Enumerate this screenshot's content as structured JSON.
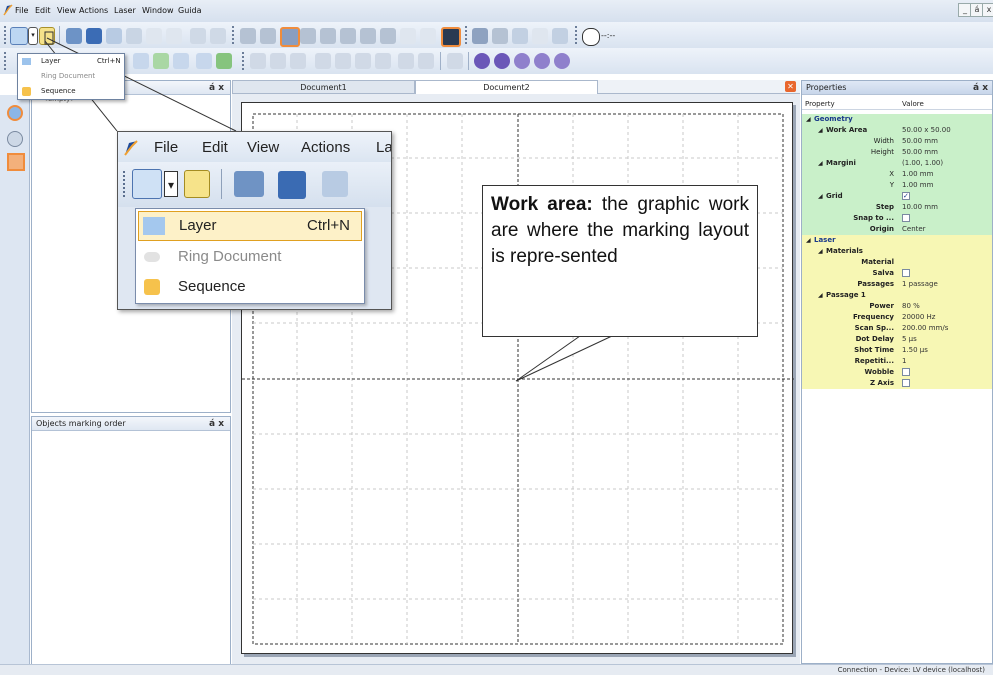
{
  "menubar": {
    "items": [
      "File",
      "Edit",
      "View",
      "Actions",
      "Laser",
      "Window",
      "Guida"
    ],
    "window_buttons": [
      "_",
      "á",
      "x"
    ]
  },
  "toolbar": {
    "time_readout": "--:--"
  },
  "dropdown": {
    "items": [
      {
        "label": "Layer",
        "shortcut": "Ctrl+N",
        "enabled": true
      },
      {
        "label": "Ring Document",
        "shortcut": "",
        "enabled": false
      },
      {
        "label": "Sequence",
        "shortcut": "",
        "enabled": true
      }
    ]
  },
  "zoom_inset": {
    "menu": [
      "File",
      "Edit",
      "View",
      "Actions",
      "La"
    ],
    "items": [
      {
        "label": "Layer",
        "shortcut": "Ctrl+N"
      },
      {
        "label": "Ring Document",
        "shortcut": ""
      },
      {
        "label": "Sequence",
        "shortcut": ""
      }
    ]
  },
  "layers_panel": {
    "empty_text": "<empty>",
    "buttons": "á x"
  },
  "order_panel": {
    "title": "Objects marking order",
    "buttons": "á x"
  },
  "documents": {
    "tabs": [
      "Document1",
      "Document2"
    ],
    "active": 1
  },
  "callout": {
    "bold": "Work area:",
    "text": " the graphic work are where the marking layout is repre-sented"
  },
  "properties": {
    "title": "Properties",
    "buttons": "á x",
    "col_property": "Property",
    "col_value": "Valore",
    "rows": [
      {
        "name": "Geometry",
        "value": "",
        "level": 0,
        "type": "section",
        "expander": "◢",
        "bg": "#c9f0c9"
      },
      {
        "name": "Work Area",
        "value": "50.00 x 50.00",
        "level": 1,
        "type": "group",
        "expander": "◢",
        "bg": "#c9f0c9"
      },
      {
        "name": "Width",
        "value": "50.00 mm",
        "level": 2,
        "type": "prop",
        "bg": "#c9f0c9"
      },
      {
        "name": "Height",
        "value": "50.00 mm",
        "level": 2,
        "type": "prop",
        "bg": "#c9f0c9"
      },
      {
        "name": "Margini",
        "value": "(1.00, 1.00)",
        "level": 1,
        "type": "group",
        "expander": "◢",
        "bg": "#c9f0c9"
      },
      {
        "name": "X",
        "value": "1.00 mm",
        "level": 2,
        "type": "prop",
        "bg": "#c9f0c9"
      },
      {
        "name": "Y",
        "value": "1.00 mm",
        "level": 2,
        "type": "prop",
        "bg": "#c9f0c9"
      },
      {
        "name": "Grid",
        "value": "",
        "level": 1,
        "type": "group",
        "expander": "◢",
        "checkbox": true,
        "checked": true,
        "bg": "#c9f0c9"
      },
      {
        "name": "Step",
        "value": "10.00 mm",
        "level": 2,
        "type": "bold",
        "bg": "#c9f0c9"
      },
      {
        "name": "Snap to ...",
        "value": "",
        "level": 2,
        "type": "bold",
        "checkbox": true,
        "checked": false,
        "bg": "#c9f0c9"
      },
      {
        "name": "Origin",
        "value": "Center",
        "level": 1,
        "type": "bold",
        "bg": "#c9f0c9"
      },
      {
        "name": "Laser",
        "value": "",
        "level": 0,
        "type": "section",
        "expander": "◢",
        "bg": "#f7f7b4"
      },
      {
        "name": "Materials",
        "value": "",
        "level": 1,
        "type": "group",
        "expander": "◢",
        "bg": "#f7f7b4"
      },
      {
        "name": "Material",
        "value": "",
        "level": 2,
        "type": "bold",
        "bg": "#f7f7b4"
      },
      {
        "name": "Salva",
        "value": "",
        "level": 2,
        "type": "bold",
        "checkbox": true,
        "checked": false,
        "bg": "#f7f7b4"
      },
      {
        "name": "Passages",
        "value": "1 passage",
        "level": 1,
        "type": "bold",
        "bg": "#f7f7b4"
      },
      {
        "name": "Passage 1",
        "value": "",
        "level": 1,
        "type": "group",
        "expander": "◢",
        "bg": "#f7f7b4"
      },
      {
        "name": "Power",
        "value": "80 %",
        "level": 2,
        "type": "bold",
        "bg": "#f7f7b4"
      },
      {
        "name": "Frequency",
        "value": "20000 Hz",
        "level": 2,
        "type": "bold",
        "bg": "#f7f7b4"
      },
      {
        "name": "Scan Sp...",
        "value": "200.00 mm/s",
        "level": 2,
        "type": "bold",
        "bg": "#f7f7b4"
      },
      {
        "name": "Dot Delay",
        "value": "5 µs",
        "level": 2,
        "type": "bold",
        "bg": "#f7f7b4"
      },
      {
        "name": "Shot Time",
        "value": "1.50 µs",
        "level": 2,
        "type": "bold",
        "bg": "#f7f7b4"
      },
      {
        "name": "Repetiti...",
        "value": "1",
        "level": 2,
        "type": "bold",
        "bg": "#f7f7b4"
      },
      {
        "name": "Wobble",
        "value": "",
        "level": 1,
        "type": "bold",
        "checkbox": true,
        "checked": false,
        "bg": "#f7f7b4"
      },
      {
        "name": "Z Axis",
        "value": "",
        "level": 1,
        "type": "bold",
        "checkbox": true,
        "checked": false,
        "bg": "#f7f7b4"
      }
    ]
  },
  "status": {
    "text": "Connection - Device: LV device (localhost)"
  },
  "colors": {
    "accent": "#f08c3c",
    "frame": "#6f86a8"
  }
}
